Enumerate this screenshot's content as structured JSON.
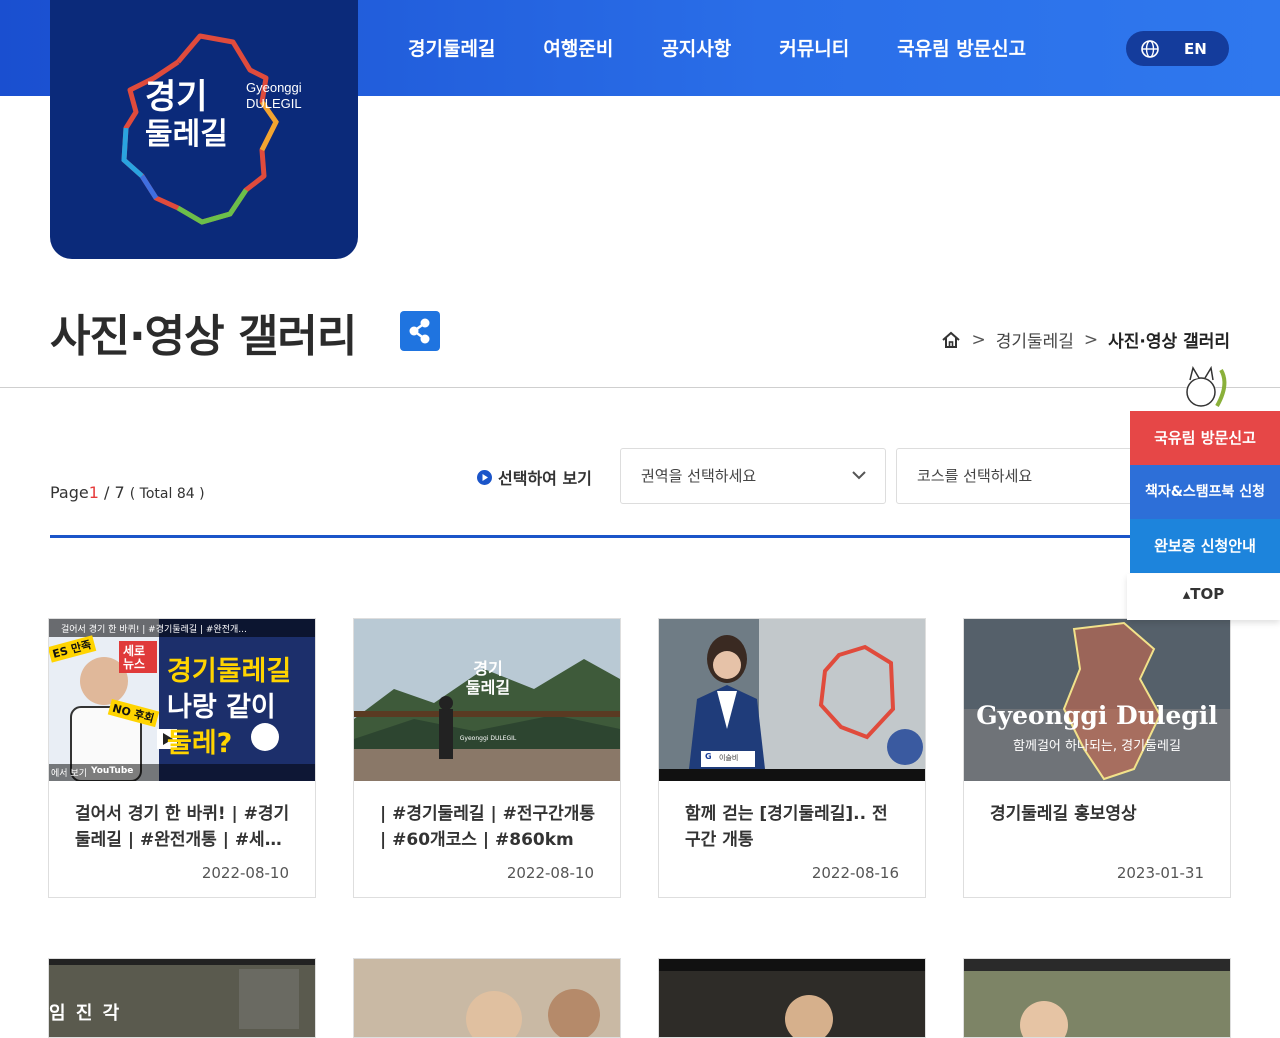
{
  "header": {
    "logo": {
      "ko_line1": "경기",
      "ko_line2": "둘레길",
      "en_line1": "Gyeonggi",
      "en_line2": "DULEGIL"
    },
    "nav": [
      "경기둘레길",
      "여행준비",
      "공지사항",
      "커뮤니티",
      "국유림 방문신고"
    ],
    "lang_label": "EN"
  },
  "page": {
    "title": "사진·영상 갤러리",
    "breadcrumb": [
      "경기둘레길",
      "사진·영상 갤러리"
    ]
  },
  "list": {
    "page_label": "Page",
    "current_page": "1",
    "total_pages": "/ 7",
    "total_text": "( Total 84 )",
    "select_heading": "선택하여 보기",
    "region_placeholder": "권역을 선택하세요",
    "course_placeholder": "코스를 선택하세요"
  },
  "cards": [
    {
      "title": "걸어서 경기 한 바퀴! | #경기둘레길 | #완전개통 | #세…",
      "date": "2022-08-10",
      "thumb": {
        "top_caption": "걸어서 경기 한 바퀴! | #경기둘레길 | #완전개...",
        "badge": "세로 뉴스",
        "tag_es": "ES 만족",
        "tag_no": "NO 후회",
        "main_1": "경기둘레길",
        "main_2": "나랑 같이",
        "main_3": "둘레?",
        "yt": "YouTube",
        "left_note": "에서 보기"
      }
    },
    {
      "title": "| #경기둘레길 | #전구간개통 | #60개코스 | #860km",
      "date": "2022-08-10",
      "thumb": {
        "logo_1": "경기",
        "logo_2": "둘레길",
        "logo_en": "Gyeonggi DULEGIL"
      }
    },
    {
      "title": "함께 걷는 [경기둘레길].. 전구간 개통",
      "date": "2022-08-16",
      "thumb": {
        "channel": "G",
        "name": "이슬비"
      }
    },
    {
      "title": "경기둘레길 홍보영상",
      "date": "2023-01-31",
      "thumb": {
        "headline": "Gyeonggi Dulegil",
        "sub": "함께걸어 하나되는, 경기둘레길"
      }
    }
  ],
  "cards_row2": [
    {
      "tag": "임 진 각"
    },
    {},
    {},
    {}
  ],
  "quick": {
    "items": [
      "국유림 방문신고",
      "책자&스탬프북 신청",
      "완보증 신청안내"
    ],
    "top_label": "TOP"
  },
  "colors": {
    "nav_bg": "#2a6ee8",
    "logo_bg": "#0b2a7a",
    "accent_red": "#e63b3b",
    "accent_blue": "#1b55c9"
  }
}
